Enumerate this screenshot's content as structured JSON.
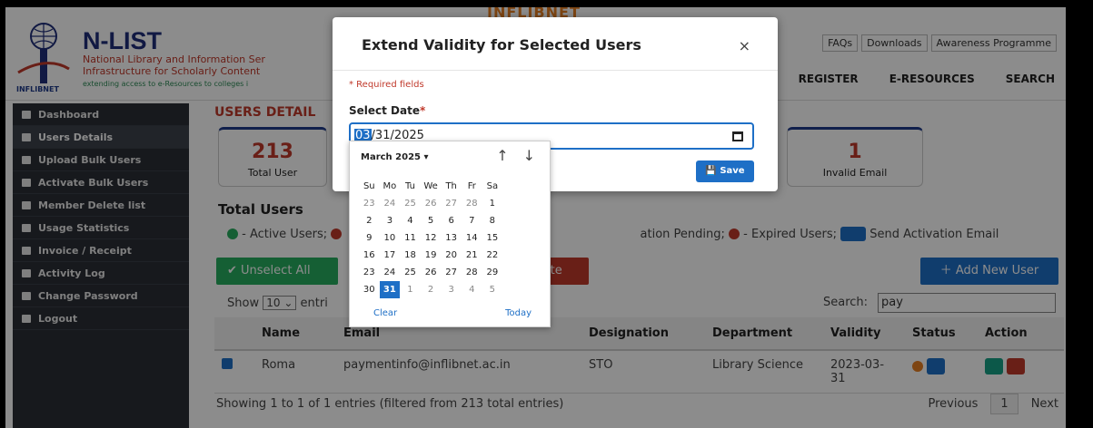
{
  "header": {
    "banner": "INFLIBNET",
    "brand": "N-LIST",
    "tagline1": "National Library and Information Ser",
    "tagline2": "Infrastructure for Scholarly Content",
    "tagline3": "extending access to e-Resources to colleges i",
    "logo_text": "INFLIBNET",
    "top_links": [
      "FAQs",
      "Downloads",
      "Awareness Programme"
    ],
    "nav": [
      "REGISTER",
      "E-RESOURCES",
      "SEARCH"
    ]
  },
  "sidebar": {
    "items": [
      {
        "label": "Dashboard",
        "icon": "dashboard-icon"
      },
      {
        "label": "Users Details",
        "icon": "users-icon"
      },
      {
        "label": "Upload Bulk Users",
        "icon": "upload-users-icon"
      },
      {
        "label": "Activate Bulk Users",
        "icon": "check-square-icon"
      },
      {
        "label": "Member Delete list",
        "icon": "trash-icon"
      },
      {
        "label": "Usage Statistics",
        "icon": "bar-chart-icon"
      },
      {
        "label": "Invoice / Receipt",
        "icon": "print-icon"
      },
      {
        "label": "Activity Log",
        "icon": "log-icon"
      },
      {
        "label": "Change Password",
        "icon": "key-icon"
      },
      {
        "label": "Logout",
        "icon": "logout-icon"
      }
    ]
  },
  "main": {
    "section_title": "USERS DETAIL",
    "stats": [
      {
        "num": "213",
        "label": "Total User"
      },
      {
        "num": "1",
        "label": "Invalid Email"
      }
    ],
    "total_users_heading": "Total Users",
    "legend": {
      "active": "- Active Users;",
      "pending": "ation Pending;",
      "expired": "- Expired Users;",
      "send": "Send Activation Email"
    },
    "unselect_all": "Unselect All",
    "delete_label": "lete",
    "add_new_user": "Add New User",
    "show_label": "Show",
    "show_value": "10",
    "entries_label": "entri",
    "search_label": "Search:",
    "search_value": "pay",
    "table": {
      "headers": [
        "Name",
        "Email",
        "Designation",
        "Department",
        "Validity",
        "Status",
        "Action"
      ],
      "rows": [
        {
          "name": "Roma",
          "email": "paymentinfo@inflibnet.ac.in",
          "designation": "STO",
          "department": "Library Science",
          "validity": "2023-03-31"
        }
      ]
    },
    "footer_info": "Showing 1 to 1 of 1 entries (filtered from 213 total entries)",
    "pager": {
      "prev": "Previous",
      "page": "1",
      "next": "Next"
    }
  },
  "modal": {
    "title": "Extend Validity for Selected Users",
    "close": "×",
    "required_note": "* Required fields",
    "date_label": "Select Date",
    "date_star": "*",
    "date_month_sel": "03",
    "date_rest": "/31/2025",
    "save": "Save"
  },
  "calendar": {
    "month": "March 2025 ▾",
    "up": "↑",
    "down": "↓",
    "weekdays": [
      "Su",
      "Mo",
      "Tu",
      "We",
      "Th",
      "Fr",
      "Sa"
    ],
    "weeks": [
      [
        "23",
        "24",
        "25",
        "26",
        "27",
        "28",
        "1"
      ],
      [
        "2",
        "3",
        "4",
        "5",
        "6",
        "7",
        "8"
      ],
      [
        "9",
        "10",
        "11",
        "12",
        "13",
        "14",
        "15"
      ],
      [
        "16",
        "17",
        "18",
        "19",
        "20",
        "21",
        "22"
      ],
      [
        "23",
        "24",
        "25",
        "26",
        "27",
        "28",
        "29"
      ],
      [
        "30",
        "31",
        "1",
        "2",
        "3",
        "4",
        "5"
      ]
    ],
    "selected": "31",
    "clear": "Clear",
    "today": "Today"
  },
  "colors": {
    "accent": "#1e6fc6",
    "danger": "#c0392b",
    "success": "#27ae60",
    "sidebar": "#2b2f36"
  }
}
